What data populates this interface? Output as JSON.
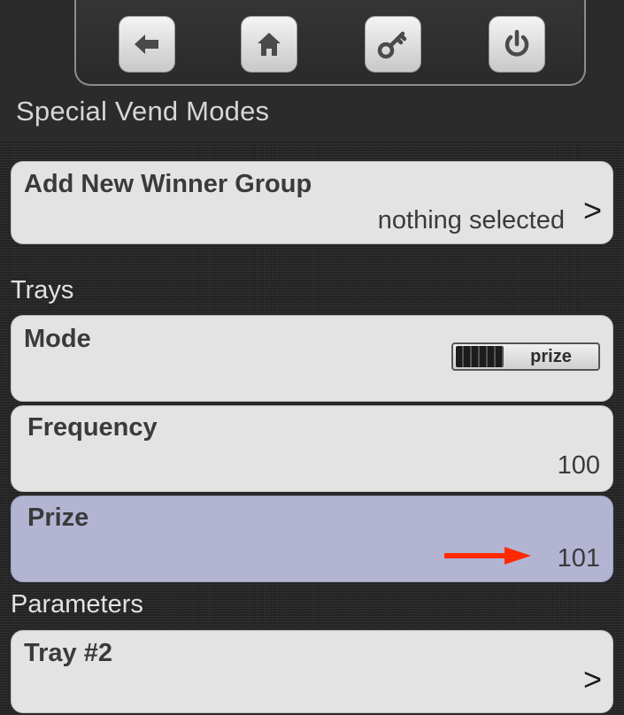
{
  "toolbar": {
    "buttons": [
      {
        "icon": "back-arrow-icon"
      },
      {
        "icon": "home-icon"
      },
      {
        "icon": "key-icon"
      },
      {
        "icon": "power-icon"
      }
    ]
  },
  "header": {
    "title": "Special Vend Modes"
  },
  "winner_group": {
    "title": "Add New Winner Group",
    "value": "nothing selected",
    "chevron": ">"
  },
  "trays": {
    "label": "Trays",
    "mode": {
      "title": "Mode",
      "toggle_value": "prize"
    },
    "frequency": {
      "title": "Frequency",
      "value": "100"
    },
    "prize": {
      "title": "Prize",
      "value": "101",
      "selected": true
    }
  },
  "parameters": {
    "label": "Parameters",
    "tray": {
      "title": "Tray #2",
      "chevron": ">"
    }
  },
  "colors": {
    "background": "#262626",
    "row": "#e3e3e3",
    "selected_row": "#b3b4d2",
    "annotation_arrow": "#ff2a00"
  }
}
